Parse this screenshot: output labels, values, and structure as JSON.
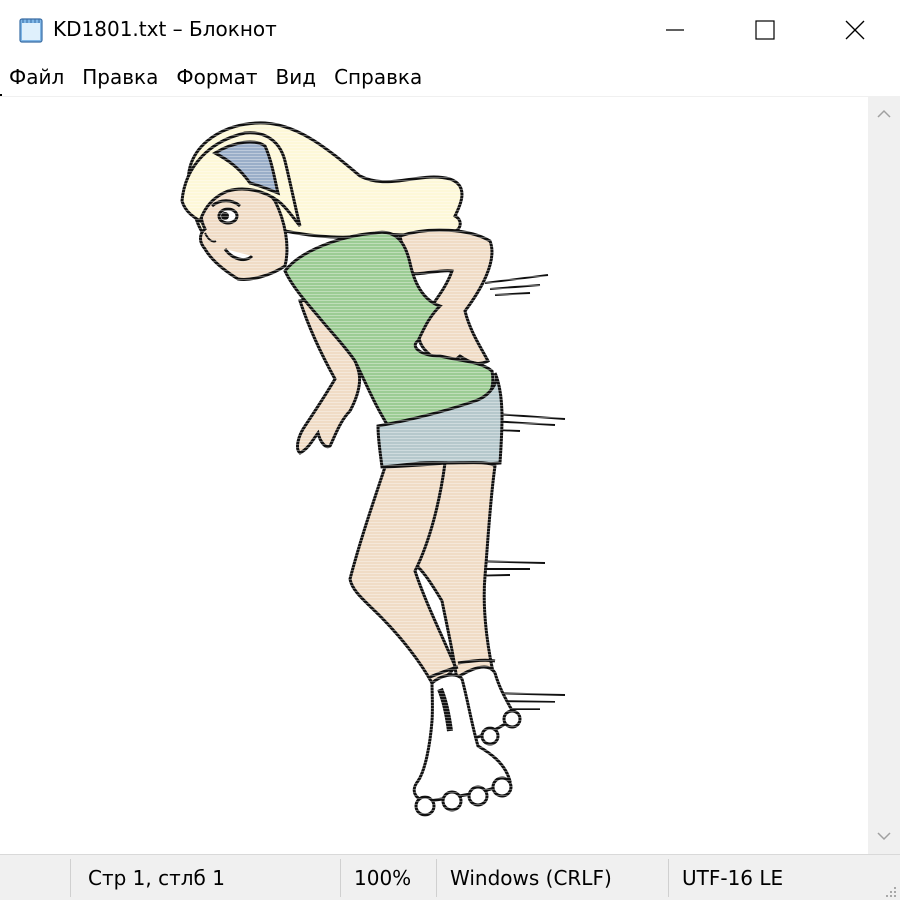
{
  "window": {
    "title": "KD1801.txt – Блокнот",
    "controls": {
      "minimize_icon": "minimize-icon",
      "maximize_icon": "maximize-icon",
      "close_icon": "close-icon"
    }
  },
  "menu": {
    "items": [
      {
        "label": "Файл"
      },
      {
        "label": "Правка"
      },
      {
        "label": "Формат"
      },
      {
        "label": "Вид"
      },
      {
        "label": "Справка"
      }
    ]
  },
  "editor": {
    "content_description_icon": "ascii-art-rollerblade-girl"
  },
  "status": {
    "position": "Стр 1, стлб 1",
    "zoom": "100%",
    "line_endings": "Windows (CRLF)",
    "encoding": "UTF-16 LE"
  },
  "colors": {
    "hair": "#fdf8d8",
    "headband": "#9aaec8",
    "skin": "#f0dcc6",
    "shirt": "#9ccc94",
    "shorts": "#b6c8cc",
    "outline": "#111111"
  }
}
